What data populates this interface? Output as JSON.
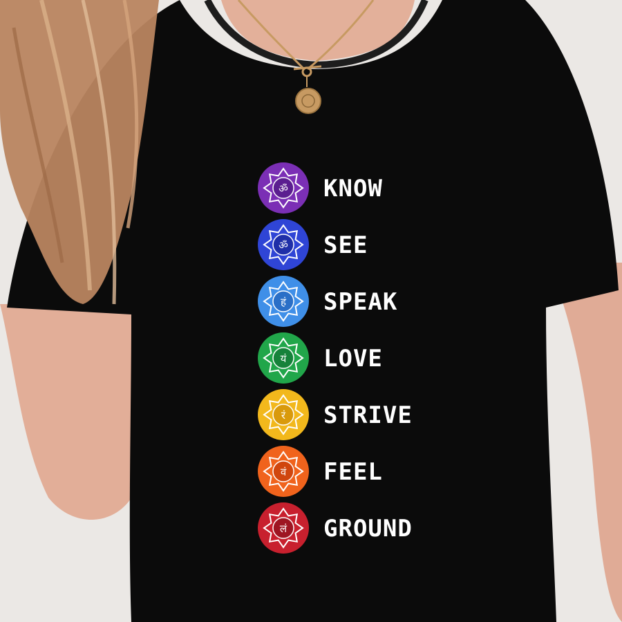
{
  "shirt_print": {
    "chakras": [
      {
        "word": "KNOW",
        "color": "#7b2fb5",
        "ring": "#5b1e90",
        "symbol": "ॐ"
      },
      {
        "word": "SEE",
        "color": "#2f45d6",
        "ring": "#1f2fa8",
        "symbol": "ॐ"
      },
      {
        "word": "SPEAK",
        "color": "#3f8fe8",
        "ring": "#2a6fc7",
        "symbol": "हं"
      },
      {
        "word": "LOVE",
        "color": "#21a64a",
        "ring": "#16823a",
        "symbol": "यं"
      },
      {
        "word": "STRIVE",
        "color": "#f2b81c",
        "ring": "#d99a0c",
        "symbol": "रं"
      },
      {
        "word": "FEEL",
        "color": "#f0631c",
        "ring": "#d0460e",
        "symbol": "वं"
      },
      {
        "word": "GROUND",
        "color": "#c8202e",
        "ring": "#9e1522",
        "symbol": "लं"
      }
    ]
  },
  "palette": {
    "shirt": "#0b0b0b",
    "skin": "#e0ab96",
    "hair": "#b98560",
    "background": "#ebe8e5",
    "necklace": "#c79a62"
  }
}
